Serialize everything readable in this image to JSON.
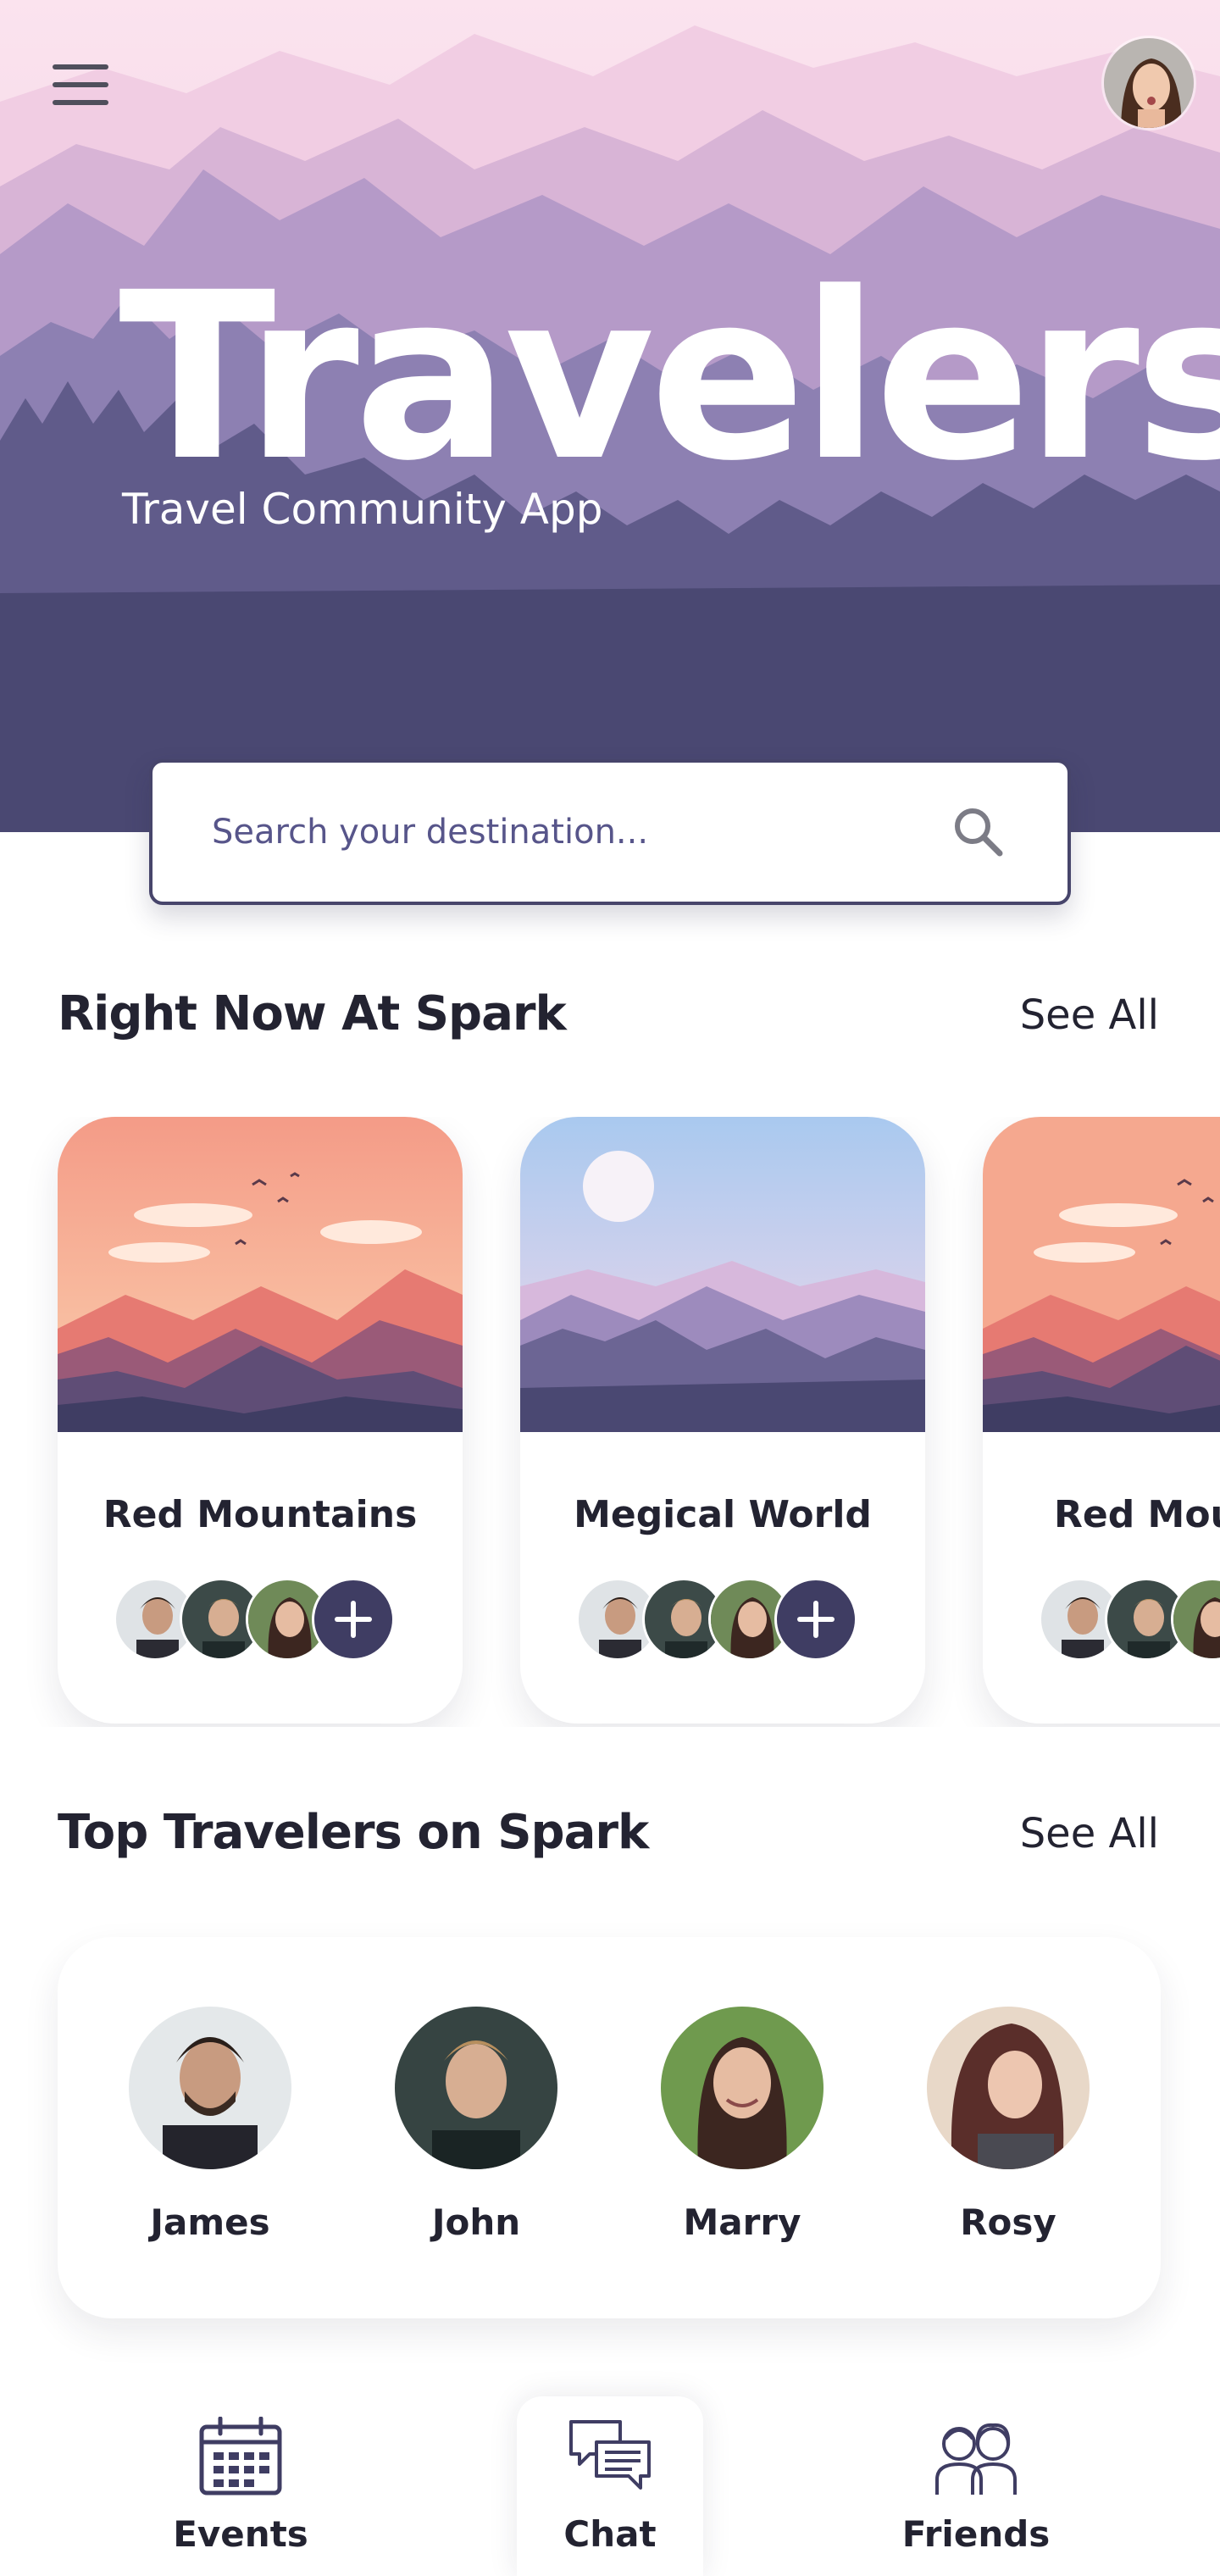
{
  "header": {
    "title": "Travelers",
    "subtitle": "Travel Community App",
    "menu_icon": "hamburger-menu-icon",
    "profile_avatar": "user-avatar"
  },
  "search": {
    "placeholder": "Search your destination...",
    "icon": "search-icon"
  },
  "right_now": {
    "title": "Right Now At Spark",
    "see_all": "See All",
    "cards": [
      {
        "title": "Red Mountains",
        "scene": "sunset-mountains"
      },
      {
        "title": "Megical World",
        "scene": "purple-mountains"
      },
      {
        "title": "Red Mountains",
        "scene": "sunset-mountains"
      }
    ]
  },
  "top_travelers": {
    "title": "Top Travelers on Spark",
    "see_all": "See All",
    "people": [
      {
        "name": "James"
      },
      {
        "name": "John"
      },
      {
        "name": "Marry"
      },
      {
        "name": "Rosy"
      }
    ]
  },
  "bottom_nav": {
    "items": [
      {
        "label": "Events",
        "icon": "calendar-icon",
        "active": false
      },
      {
        "label": "Chat",
        "icon": "chat-bubbles-icon",
        "active": true
      },
      {
        "label": "Friends",
        "icon": "friends-icon",
        "active": false
      }
    ]
  },
  "colors": {
    "primary": "#3f3d63",
    "hero_pink": "#f7d6e6",
    "hero_dark": "#4a4872",
    "sunset_orange": "#f4907a"
  }
}
